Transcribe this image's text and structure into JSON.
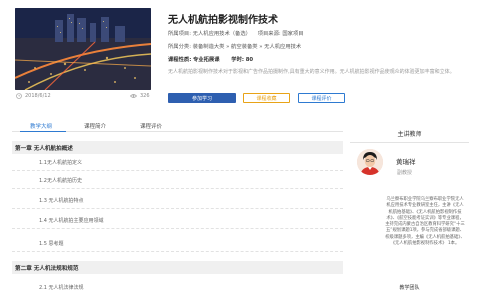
{
  "course": {
    "title": "无人机航拍影视制作技术",
    "major_label": "所属项目:",
    "major_value": "无人机应用技术（备选）",
    "source_label": "项目来源:",
    "source_value": "国家项目",
    "category_label": "所属分类:",
    "category_value": "装备制造大类 » 航空装备类 » 无人机应用技术",
    "nature_label": "课程性质:",
    "nature_value": "专业拓展课",
    "credit_label": "学时:",
    "credit_value": "80",
    "description": "无人机航拍影视制作技术对于影视和广告作品拍摄制作,具有重大的意义作用。无人机航拍影视作品使观众的体验更加丰富和立体。",
    "date": "2018/6/12",
    "views": "326"
  },
  "actions": {
    "join": "参加学习",
    "favorite": "课程收藏",
    "evaluate": "课程评价"
  },
  "tabs": [
    "教学大纲",
    "课程简介",
    "课程评价"
  ],
  "chapters": [
    {
      "title": "第一章 无人机航拍概述",
      "lessons": [
        "1.1无人机航拍定义",
        "1.2无人机航拍历史",
        "1.3 无人机航拍特点",
        "1.4 无人机航拍主要应用领域",
        "1.5 思考题"
      ]
    },
    {
      "title": "第二章 无人机法规和规范",
      "lessons": [
        "2.1 无人机法律法规"
      ]
    }
  ],
  "teacher": {
    "section_title": "主讲教师",
    "name": "黄瑞祥",
    "rank": "副教授",
    "bio": "乌兰察布职业学院乌兰察布职业学院无人机应用技术专业教研室主任，主讲《无人机航拍基础》、《无人机航拍影视制作技术》、《航空技能考证实训》等专业课程，主持完成内蒙古自治区教育科学研究“十三五”规划课题1项，参与完成省部级课题、校级课题多项，主编《无人机航拍基础》、《无人机航拍影视制作技术》 1本。"
  },
  "team_title": "教学团队"
}
